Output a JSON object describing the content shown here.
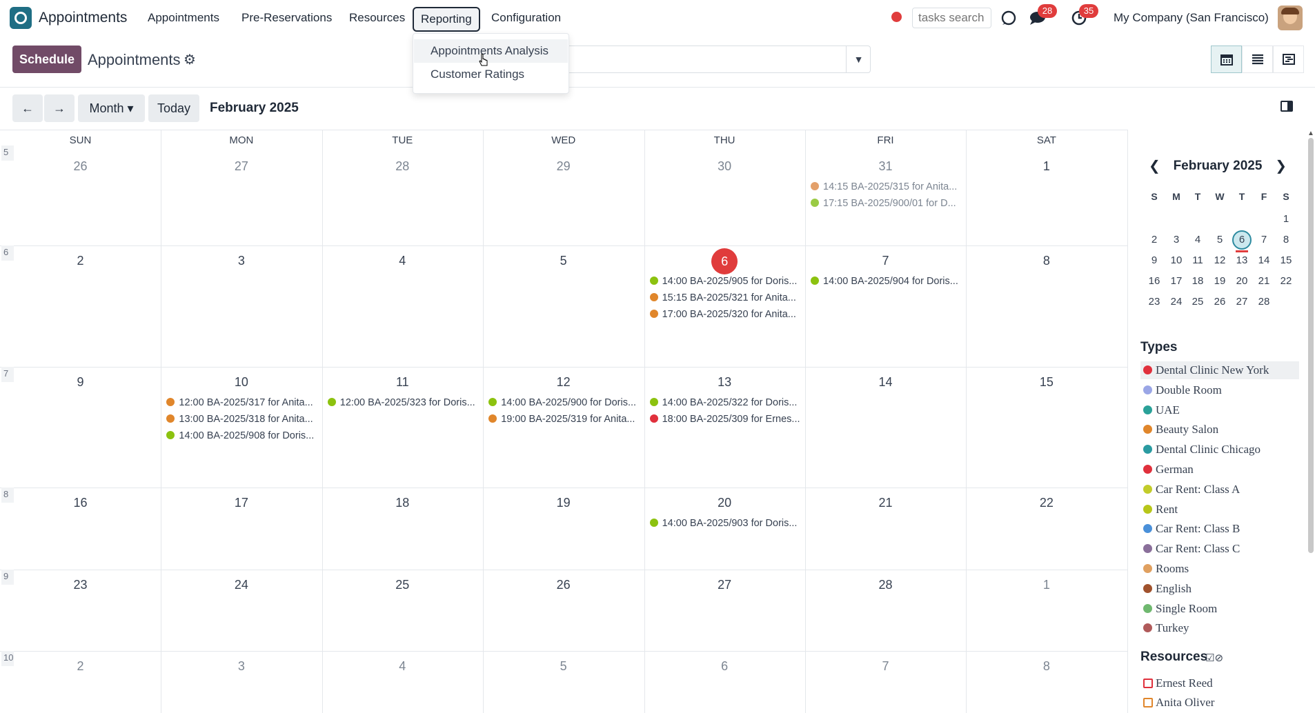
{
  "nav": {
    "app_name": "Appointments",
    "menu": [
      "Appointments",
      "Pre-Reservations",
      "Resources",
      "Reporting",
      "Configuration"
    ],
    "active_menu": "Reporting",
    "tasks_search_placeholder": "tasks search",
    "messages_count": "28",
    "activities_count": "35",
    "company": "My Company (San Francisco)"
  },
  "dropdown": {
    "items": [
      "Appointments Analysis",
      "Customer Ratings"
    ]
  },
  "control": {
    "schedule_label": "Schedule",
    "page_title": "Appointments"
  },
  "toolbar": {
    "prev_label": "←",
    "next_label": "→",
    "scale_label": "Month ▾",
    "today_label": "Today",
    "period_title": "February 2025"
  },
  "calendar": {
    "weekdays": [
      "SUN",
      "MON",
      "TUE",
      "WED",
      "THU",
      "FRI",
      "SAT"
    ],
    "weeks": [
      {
        "number": "5",
        "days": [
          "26",
          "27",
          "28",
          "29",
          "30",
          "31",
          "1"
        ]
      },
      {
        "number": "6",
        "days": [
          "2",
          "3",
          "4",
          "5",
          "6",
          "7",
          "8"
        ]
      },
      {
        "number": "7",
        "days": [
          "9",
          "10",
          "11",
          "12",
          "13",
          "14",
          "15"
        ]
      },
      {
        "number": "8",
        "days": [
          "16",
          "17",
          "18",
          "19",
          "20",
          "21",
          "22"
        ]
      },
      {
        "number": "9",
        "days": [
          "23",
          "24",
          "25",
          "26",
          "27",
          "28",
          "1"
        ]
      },
      {
        "number": "10",
        "days": [
          "2",
          "3",
          "4",
          "5",
          "6",
          "7",
          "8"
        ]
      }
    ],
    "today": "6",
    "events": [
      {
        "week": 0,
        "day": 5,
        "text": "14:15 BA-2025/315 for Anita...",
        "color": "#e3a06a",
        "muted": true
      },
      {
        "week": 0,
        "day": 5,
        "text": "17:15 BA-2025/900/01 for D...",
        "color": "#9acb44",
        "muted": true
      },
      {
        "week": 1,
        "day": 4,
        "text": "14:00 BA-2025/905 for Doris...",
        "color": "#8cc20f"
      },
      {
        "week": 1,
        "day": 4,
        "text": "15:15 BA-2025/321 for Anita...",
        "color": "#e0862b"
      },
      {
        "week": 1,
        "day": 4,
        "text": "17:00 BA-2025/320 for Anita...",
        "color": "#e0862b"
      },
      {
        "week": 1,
        "day": 5,
        "text": "14:00 BA-2025/904 for Doris...",
        "color": "#8cc20f"
      },
      {
        "week": 2,
        "day": 1,
        "text": "12:00 BA-2025/317 for Anita...",
        "color": "#e0862b"
      },
      {
        "week": 2,
        "day": 1,
        "text": "13:00 BA-2025/318 for Anita...",
        "color": "#e0862b"
      },
      {
        "week": 2,
        "day": 1,
        "text": "14:00 BA-2025/908 for Doris...",
        "color": "#8cc20f"
      },
      {
        "week": 2,
        "day": 2,
        "text": "12:00 BA-2025/323 for Doris...",
        "color": "#8cc20f"
      },
      {
        "week": 2,
        "day": 3,
        "text": "14:00 BA-2025/900 for Doris...",
        "color": "#8cc20f"
      },
      {
        "week": 2,
        "day": 3,
        "text": "19:00 BA-2025/319 for Anita...",
        "color": "#e0862b"
      },
      {
        "week": 2,
        "day": 4,
        "text": "14:00 BA-2025/322 for Doris...",
        "color": "#8cc20f"
      },
      {
        "week": 2,
        "day": 4,
        "text": "18:00 BA-2025/309 for Ernes...",
        "color": "#e0303c"
      },
      {
        "week": 3,
        "day": 4,
        "text": "14:00 BA-2025/903 for Doris...",
        "color": "#8cc20f"
      }
    ]
  },
  "sidebar": {
    "mini_title": "February 2025",
    "mini_weekdays": [
      "S",
      "M",
      "T",
      "W",
      "T",
      "F",
      "S"
    ],
    "mini_rows": [
      [
        "",
        "",
        "",
        "",
        "",
        "",
        "1"
      ],
      [
        "2",
        "3",
        "4",
        "5",
        "6",
        "7",
        "8"
      ],
      [
        "9",
        "10",
        "11",
        "12",
        "13",
        "14",
        "15"
      ],
      [
        "16",
        "17",
        "18",
        "19",
        "20",
        "21",
        "22"
      ],
      [
        "23",
        "24",
        "25",
        "26",
        "27",
        "28",
        ""
      ]
    ],
    "types_title": "Types",
    "types": [
      {
        "label": "Dental Clinic New York",
        "color": "#e0303c"
      },
      {
        "label": "Double Room",
        "color": "#9aa6e6"
      },
      {
        "label": "UAE",
        "color": "#2aa198"
      },
      {
        "label": "Beauty Salon",
        "color": "#e0862b"
      },
      {
        "label": "Dental Clinic Chicago",
        "color": "#2a9ba1"
      },
      {
        "label": "German",
        "color": "#e0303c"
      },
      {
        "label": "Car Rent: Class A",
        "color": "#c2cc2a"
      },
      {
        "label": "Rent",
        "color": "#b7c61a"
      },
      {
        "label": "Car Rent: Class B",
        "color": "#4a90d9"
      },
      {
        "label": "Car Rent: Class C",
        "color": "#8a6f9a"
      },
      {
        "label": "Rooms",
        "color": "#e0a060"
      },
      {
        "label": "English",
        "color": "#a0522d"
      },
      {
        "label": "Single Room",
        "color": "#6fb86f"
      },
      {
        "label": "Turkey",
        "color": "#b05a5a"
      }
    ],
    "resources_title": "Resources",
    "resources": [
      {
        "label": "Ernest Reed",
        "color": "#e0303c"
      },
      {
        "label": "Anita Oliver",
        "color": "#e0862b"
      }
    ]
  }
}
